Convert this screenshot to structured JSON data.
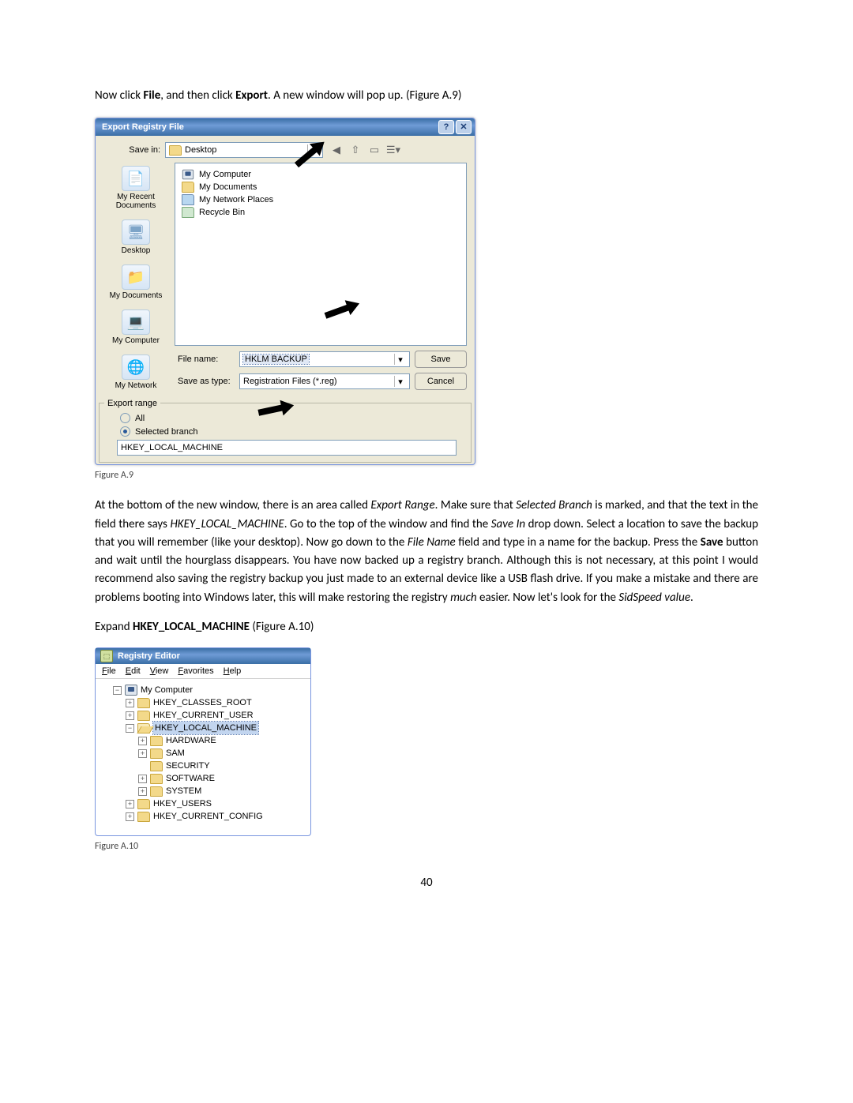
{
  "intro": {
    "pre1": "Now click ",
    "b1": "File",
    "mid1": ", and then click ",
    "b2": "Export",
    "post1": ". A new window will pop up. (Figure A.9)"
  },
  "dialog": {
    "title": "Export Registry File",
    "save_in_label": "Save in:",
    "save_in_value": "Desktop",
    "items": [
      "My Computer",
      "My Documents",
      "My Network Places",
      "Recycle Bin"
    ],
    "places": [
      "My Recent Documents",
      "Desktop",
      "My Documents",
      "My Computer",
      "My Network"
    ],
    "file_name_label": "File name:",
    "file_name_value": "HKLM BACKUP",
    "save_as_type_label": "Save as type:",
    "save_as_type_value": "Registration Files (*.reg)",
    "save_btn": "Save",
    "cancel_btn": "Cancel",
    "export_range_title": "Export range",
    "radio_all": "All",
    "radio_selected": "Selected branch",
    "selected_branch_value": "HKEY_LOCAL_MACHINE"
  },
  "caption1": "Figure A.9",
  "body": {
    "p1a": "At the bottom of the new window, there is an area called ",
    "p1b": "Export Range",
    "p1c": ". Make sure that ",
    "p1d": "Selected Branch",
    "p1e": " is marked, and that the text in the field there says ",
    "p1f": "HKEY_LOCAL_MACHINE",
    "p1g": ". Go to the top of the window and find the ",
    "p1h": "Save In",
    "p1i": " drop down. Select a location to save the backup that you will remember (like your desktop). Now go down to the ",
    "p1j": "File Name",
    "p1k": " field and type in a name for the backup. Press the ",
    "p1l": "Save",
    "p1m": " button and wait until the hourglass disappears. You have now backed up a registry branch. Although this is not necessary, at this point I would recommend also saving the registry backup you just made to an external device like a USB flash drive. If you make a mistake and there are problems booting into Windows later, this will make restoring the registry ",
    "p1n": "much",
    "p1o": " easier. Now let's look for the ",
    "p1p": "SidSpeed value",
    "p1q": "."
  },
  "expand": {
    "pre": "Expand ",
    "b": "HKEY_LOCAL_MACHINE",
    "post": " (Figure A.10)"
  },
  "regedit": {
    "title": "Registry Editor",
    "menus": [
      "File",
      "Edit",
      "View",
      "Favorites",
      "Help"
    ],
    "root": "My Computer",
    "nodes": [
      {
        "t": "HKEY_CLASSES_ROOT",
        "exp": "plus",
        "sel": false,
        "ind": "ind2"
      },
      {
        "t": "HKEY_CURRENT_USER",
        "exp": "plus",
        "sel": false,
        "ind": "ind2"
      },
      {
        "t": "HKEY_LOCAL_MACHINE",
        "exp": "minus",
        "sel": true,
        "ind": "ind2",
        "open": true
      },
      {
        "t": "HARDWARE",
        "exp": "plus",
        "sel": false,
        "ind": "ind3"
      },
      {
        "t": "SAM",
        "exp": "plus",
        "sel": false,
        "ind": "ind3"
      },
      {
        "t": "SECURITY",
        "exp": "",
        "sel": false,
        "ind": "ind3"
      },
      {
        "t": "SOFTWARE",
        "exp": "plus",
        "sel": false,
        "ind": "ind3"
      },
      {
        "t": "SYSTEM",
        "exp": "plus",
        "sel": false,
        "ind": "ind3"
      },
      {
        "t": "HKEY_USERS",
        "exp": "plus",
        "sel": false,
        "ind": "ind2"
      },
      {
        "t": "HKEY_CURRENT_CONFIG",
        "exp": "plus",
        "sel": false,
        "ind": "ind2"
      }
    ]
  },
  "caption2": "Figure A.10",
  "pagenum": "40"
}
